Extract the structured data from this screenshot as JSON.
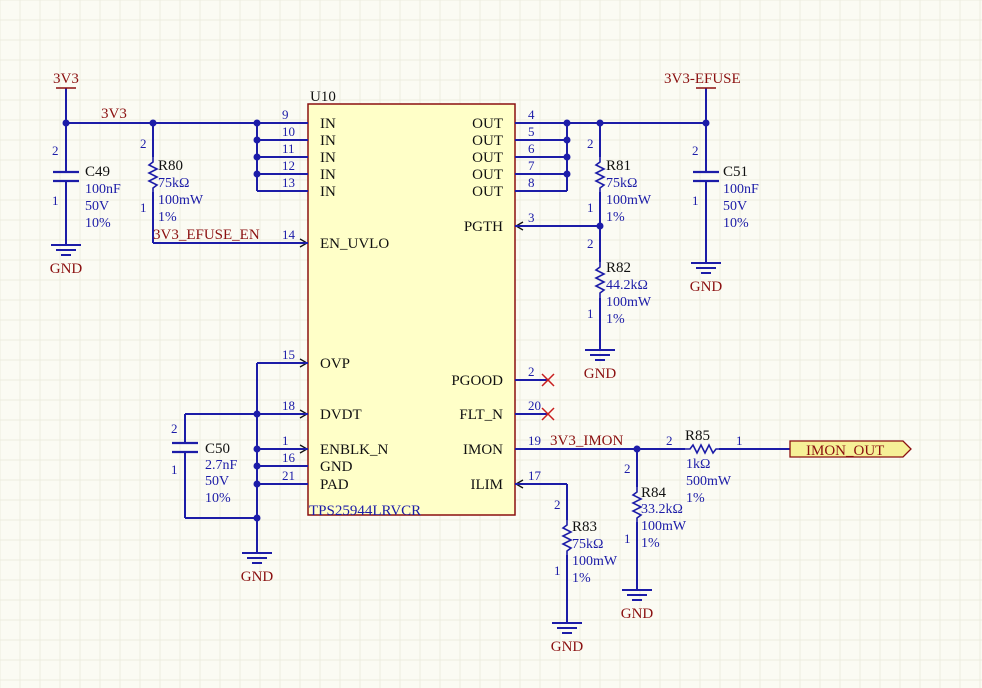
{
  "ic": {
    "designator": "U10",
    "part": "TPS25944LRVCR",
    "left_pins": [
      {
        "num": "9",
        "name": "IN"
      },
      {
        "num": "10",
        "name": "IN"
      },
      {
        "num": "11",
        "name": "IN"
      },
      {
        "num": "12",
        "name": "IN"
      },
      {
        "num": "13",
        "name": "IN"
      },
      {
        "num": "14",
        "name": "EN_UVLO"
      },
      {
        "num": "15",
        "name": "OVP"
      },
      {
        "num": "18",
        "name": "DVDT"
      },
      {
        "num": "1",
        "name": "ENBLK_N"
      },
      {
        "num": "16",
        "name": "GND"
      },
      {
        "num": "21",
        "name": "PAD"
      }
    ],
    "right_pins": [
      {
        "num": "4",
        "name": "OUT"
      },
      {
        "num": "5",
        "name": "OUT"
      },
      {
        "num": "6",
        "name": "OUT"
      },
      {
        "num": "7",
        "name": "OUT"
      },
      {
        "num": "8",
        "name": "OUT"
      },
      {
        "num": "3",
        "name": "PGTH"
      },
      {
        "num": "2",
        "name": "PGOOD"
      },
      {
        "num": "20",
        "name": "FLT_N"
      },
      {
        "num": "19",
        "name": "IMON"
      },
      {
        "num": "17",
        "name": "ILIM"
      }
    ]
  },
  "nets": {
    "vin_port": "3V3",
    "vin_wire": "3V3",
    "vout_port": "3V3-EFUSE",
    "en_net": "3V3_EFUSE_EN",
    "imon_net": "3V3_IMON",
    "imon_out": "IMON_OUT",
    "gnd": "GND"
  },
  "components": {
    "C49": {
      "des": "C49",
      "p1": "100nF",
      "p2": "50V",
      "p3": "10%",
      "pin_top": "2",
      "pin_bot": "1"
    },
    "R80": {
      "des": "R80",
      "p1": "75kΩ",
      "p2": "100mW",
      "p3": "1%",
      "pin_top": "2",
      "pin_bot": "1"
    },
    "R81": {
      "des": "R81",
      "p1": "75kΩ",
      "p2": "100mW",
      "p3": "1%",
      "pin_top": "2",
      "pin_bot": "1"
    },
    "C51": {
      "des": "C51",
      "p1": "100nF",
      "p2": "50V",
      "p3": "10%",
      "pin_top": "2",
      "pin_bot": "1"
    },
    "R82": {
      "des": "R82",
      "p1": "44.2kΩ",
      "p2": "100mW",
      "p3": "1%",
      "pin_top": "2",
      "pin_bot": "1"
    },
    "C50": {
      "des": "C50",
      "p1": "2.7nF",
      "p2": "50V",
      "p3": "10%",
      "pin_top": "2",
      "pin_bot": "1"
    },
    "R85": {
      "des": "R85",
      "p1": "1kΩ",
      "p2": "500mW",
      "p3": "1%",
      "pin_left": "2",
      "pin_right": "1"
    },
    "R84": {
      "des": "R84",
      "p1": "33.2kΩ",
      "p2": "100mW",
      "p3": "1%",
      "pin_top": "2",
      "pin_bot": "1"
    },
    "R83": {
      "des": "R83",
      "p1": "75kΩ",
      "p2": "100mW",
      "p3": "1%",
      "pin_top": "2",
      "pin_bot": "1"
    }
  },
  "colors": {
    "background": "#fbfbf3",
    "wire": "#1c1ca8",
    "ic_body": "#ffffc8",
    "power_port": "#8b1010",
    "no_connect": "#c81e1e",
    "port_fill": "#f6f097"
  }
}
